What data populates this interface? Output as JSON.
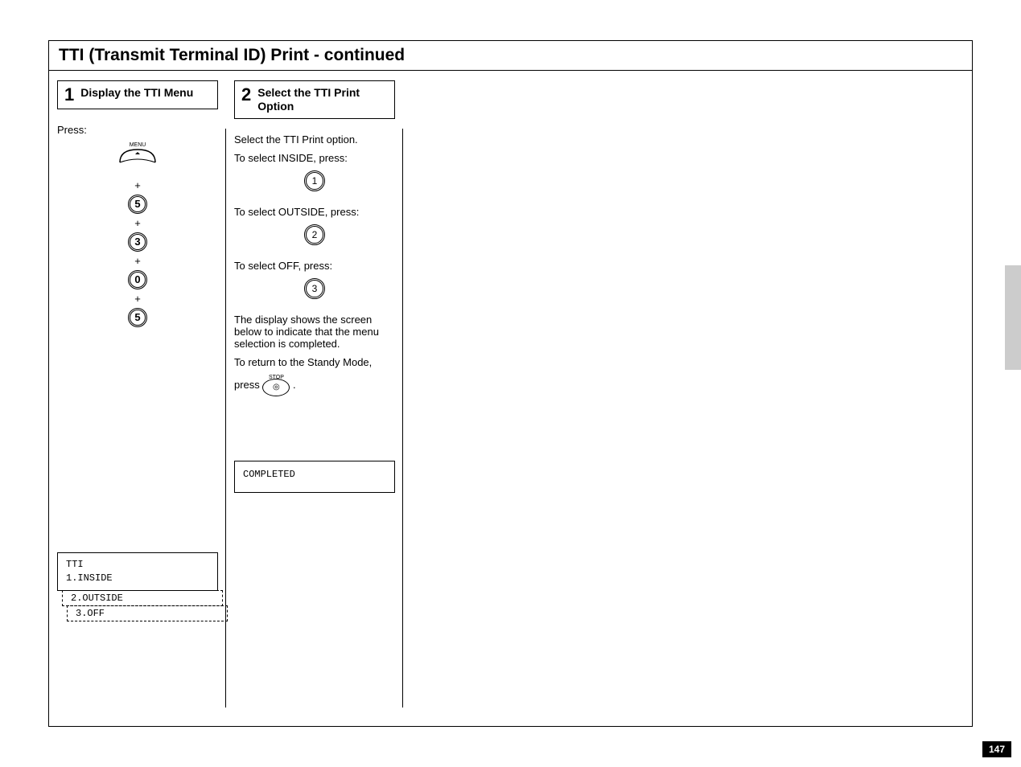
{
  "page": {
    "title": "TTI (Transmit Terminal ID) Print - continued",
    "number": "147"
  },
  "step1": {
    "num": "1",
    "label": "Display the TTI Menu",
    "press_label": "Press:",
    "menu_label": "MENU",
    "plus": "+",
    "keys": [
      "5",
      "3",
      "0",
      "5"
    ],
    "display": {
      "title": "TTI",
      "line1": "1.INSIDE",
      "line2": "2.OUTSIDE",
      "line3": "3.OFF"
    }
  },
  "step2": {
    "num": "2",
    "label": "Select the TTI Print Option",
    "intro": "Select the TTI Print option.",
    "inside_text": "To select INSIDE, press:",
    "inside_key": "1",
    "outside_text": "To select OUTSIDE, press:",
    "outside_key": "2",
    "off_text": "To select OFF, press:",
    "off_key": "3",
    "completion_text1": "The display shows the screen below to indicate that the menu selection is completed.",
    "completion_text2": "To return to the Standy Mode,",
    "press_word": "press",
    "stop_label": "STOP",
    "stop_symbol": "◎",
    "period": ".",
    "display_result": "COMPLETED"
  }
}
